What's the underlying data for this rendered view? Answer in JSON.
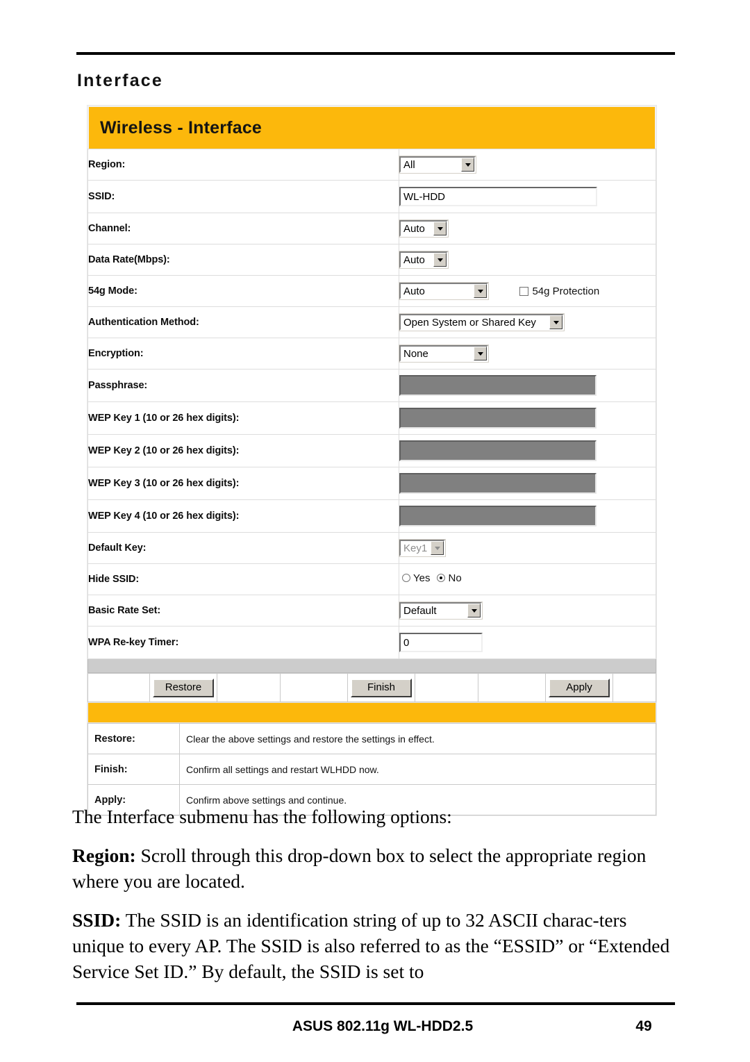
{
  "page": {
    "section_heading": "Interface",
    "footer_title": "ASUS 802.11g WL-HDD2.5",
    "footer_page": "49"
  },
  "screenshot": {
    "title": "Wireless - Interface",
    "rows": [
      {
        "label": "Region:",
        "control": "select",
        "value": "All"
      },
      {
        "label": "SSID:",
        "control": "text",
        "value": "WL-HDD"
      },
      {
        "label": "Channel:",
        "control": "select",
        "value": "Auto"
      },
      {
        "label": "Data Rate(Mbps):",
        "control": "select",
        "value": "Auto"
      },
      {
        "label": "54g Mode:",
        "control": "select",
        "value": "Auto",
        "checkbox_label": "54g Protection",
        "checkbox_checked": false
      },
      {
        "label": "Authentication Method:",
        "control": "select",
        "value": "Open System or Shared Key"
      },
      {
        "label": "Encryption:",
        "control": "select",
        "value": "None"
      },
      {
        "label": "Passphrase:",
        "control": "masked",
        "value": ""
      },
      {
        "label": "WEP Key 1 (10 or 26 hex digits):",
        "control": "masked",
        "value": ""
      },
      {
        "label": "WEP Key 2 (10 or 26 hex digits):",
        "control": "masked",
        "value": ""
      },
      {
        "label": "WEP Key 3 (10 or 26 hex digits):",
        "control": "masked",
        "value": ""
      },
      {
        "label": "WEP Key 4 (10 or 26 hex digits):",
        "control": "masked",
        "value": ""
      },
      {
        "label": "Default Key:",
        "control": "select",
        "value": "Key1",
        "disabled": true
      },
      {
        "label": "Hide SSID:",
        "control": "radio",
        "options": [
          "Yes",
          "No"
        ],
        "value": "No"
      },
      {
        "label": "Basic Rate Set:",
        "control": "select",
        "value": "Default"
      },
      {
        "label": "WPA Re-key Timer:",
        "control": "text",
        "value": "0"
      }
    ],
    "buttons": {
      "restore": "Restore",
      "finish": "Finish",
      "apply": "Apply"
    },
    "legend": [
      {
        "key": "Restore:",
        "desc": "Clear the above settings and restore the settings in effect."
      },
      {
        "key": "Finish:",
        "desc": "Confirm all settings and restart WLHDD now."
      },
      {
        "key": "Apply:",
        "desc": "Confirm above settings and continue."
      }
    ]
  },
  "body": {
    "intro": "The Interface submenu has the following options:",
    "region_term": "Region:",
    "region_text": " Scroll through this drop-down box to select the appropriate region where you are located.",
    "ssid_term": "SSID:",
    "ssid_text": " The SSID is an identification string of up to 32 ASCII charac-ters unique to every AP. The SSID is also referred to as the “ESSID” or “Extended Service Set ID.” By default, the SSID is set to"
  },
  "colors": {
    "accent_orange": "#fcb80c",
    "masked_field": "#808080",
    "button_face": "#d4d0c8"
  }
}
